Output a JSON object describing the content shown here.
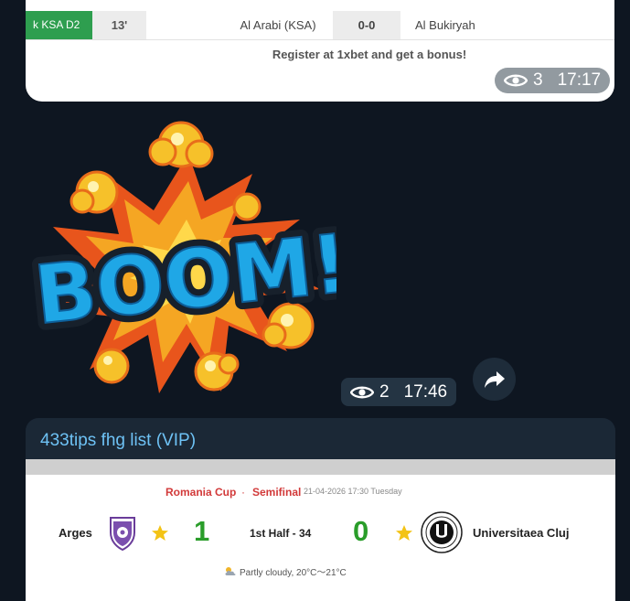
{
  "top_message": {
    "league": "k KSA D2",
    "minute": "13'",
    "home_team": "Al Arabi (KSA)",
    "score": "0-0",
    "away_team": "Al Bukiryah",
    "promo_text": "Register at 1xbet and get a bonus!",
    "views": "3",
    "time": "17:17"
  },
  "sticker_message": {
    "sticker_text": "BOOM!",
    "views": "2",
    "time": "17:46"
  },
  "vip_message": {
    "title": "433tips fhg list (VIP)",
    "competition": "Romania Cup",
    "separator": "·",
    "stage": "Semifinal",
    "datetime": "21-04-2026 17:30 Tuesday",
    "home_team": "Arges",
    "home_score": "1",
    "match_status": "1st Half - 34",
    "away_score": "0",
    "away_team": "Universitaea Cluj",
    "weather": "Partly cloudy, 20°C～21°C"
  },
  "colors": {
    "background": "#0e1621",
    "league_green": "#2e9e4f",
    "score_green": "#2a9d2a",
    "cup_red": "#d23a3a",
    "channel_title_blue": "#6ec2f5"
  }
}
